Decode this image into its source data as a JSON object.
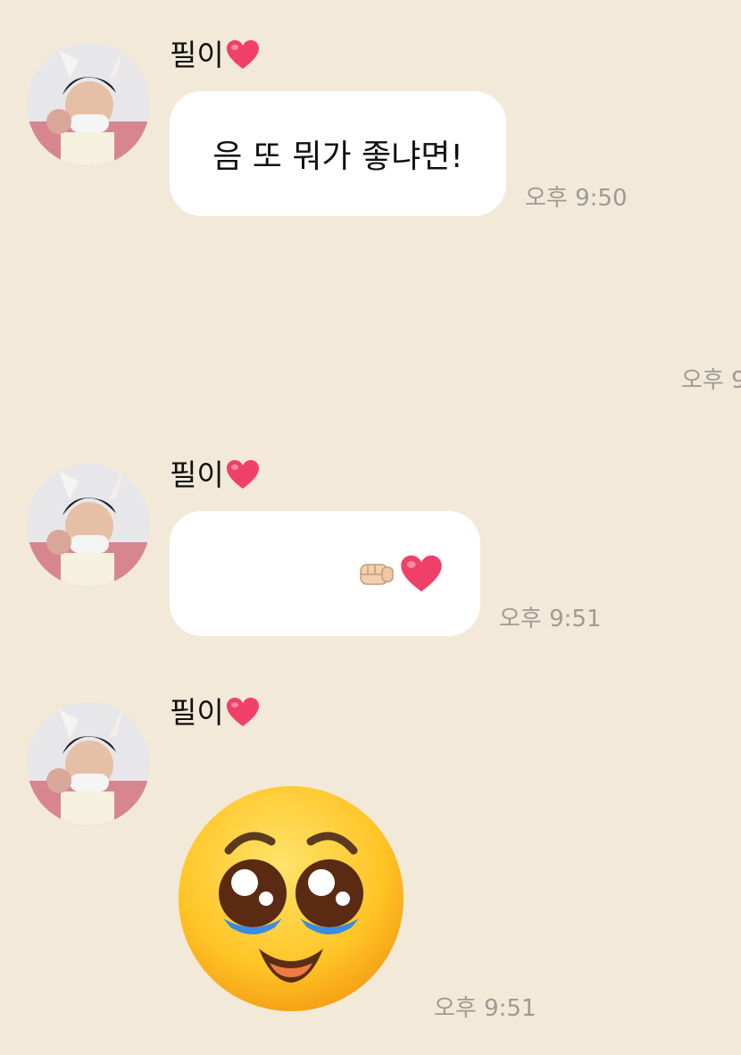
{
  "messages": [
    {
      "sender": "필이",
      "sender_emoji": "heart-icon",
      "text": "음 또 뭐가 좋냐면!",
      "time": "오후 9:50"
    },
    {
      "time": "오후 9"
    },
    {
      "sender": "필이",
      "sender_emoji": "heart-icon",
      "emojis": [
        "fist-icon",
        "heart-icon"
      ],
      "time": "오후 9:51"
    },
    {
      "sender": "필이",
      "sender_emoji": "heart-icon",
      "sticker": "pleading-face-emoji",
      "time": "오후 9:51"
    }
  ],
  "colors": {
    "background": "#f3e9d8",
    "bubble": "#ffffff",
    "heart": "#f0406a",
    "time_text": "#9d9a95"
  }
}
